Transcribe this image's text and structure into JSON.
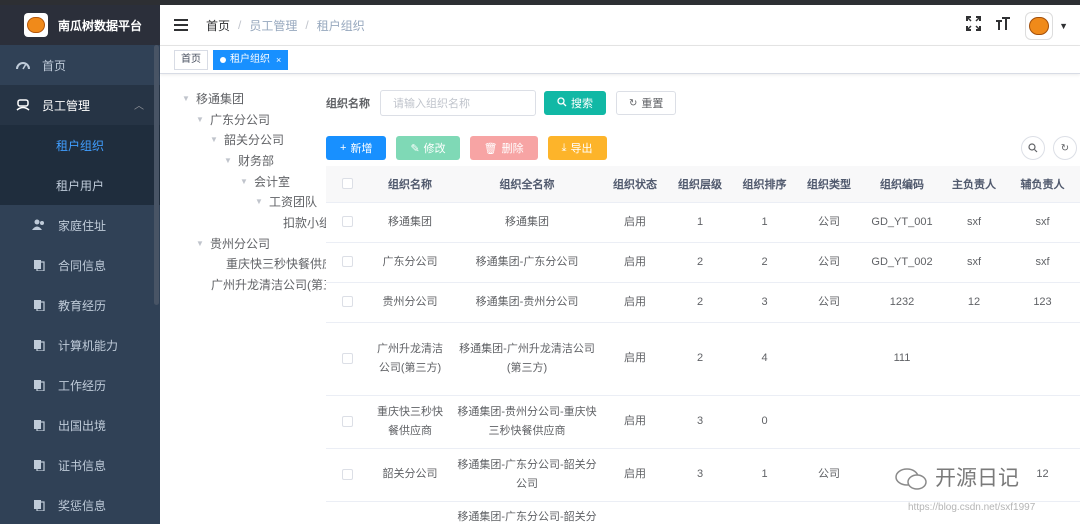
{
  "app": {
    "title": "南瓜树数据平台"
  },
  "sidebar": {
    "items": [
      {
        "label": "首页",
        "icon": "dashboard-icon"
      },
      {
        "label": "员工管理",
        "icon": "user-group-icon"
      },
      {
        "label": "租户组织",
        "icon": ""
      },
      {
        "label": "租户用户",
        "icon": ""
      },
      {
        "label": "家庭住址",
        "icon": "people-icon"
      },
      {
        "label": "合同信息",
        "icon": "document-icon"
      },
      {
        "label": "教育经历",
        "icon": "document-icon"
      },
      {
        "label": "计算机能力",
        "icon": "document-icon"
      },
      {
        "label": "工作经历",
        "icon": "document-icon"
      },
      {
        "label": "出国出境",
        "icon": "document-icon"
      },
      {
        "label": "证书信息",
        "icon": "document-icon"
      },
      {
        "label": "奖惩信息",
        "icon": "document-icon"
      }
    ]
  },
  "breadcrumb": [
    "首页",
    "员工管理",
    "租户组织"
  ],
  "tags": {
    "home": "首页",
    "current": "租户组织"
  },
  "tree": [
    "移通集团",
    "广东分公司",
    "韶关分公司",
    "财务部",
    "会计室",
    "工资团队",
    "扣款小组",
    "贵州分公司",
    "重庆快三秒快餐供应商",
    "广州升龙清洁公司(第三方)"
  ],
  "search": {
    "label": "组织名称",
    "placeholder": "请输入组织名称",
    "search_btn": "搜索",
    "reset_btn": "重置"
  },
  "toolbar": {
    "add": "新增",
    "edit": "修改",
    "delete": "删除",
    "export": "导出"
  },
  "table": {
    "headers": [
      "组织名称",
      "组织全名称",
      "组织状态",
      "组织层级",
      "组织排序",
      "组织类型",
      "组织编码",
      "主负责人",
      "辅负责人"
    ],
    "rows": [
      [
        "移通集团",
        "移通集团",
        "启用",
        "1",
        "1",
        "公司",
        "GD_YT_001",
        "sxf",
        "sxf"
      ],
      [
        "广东分公司",
        "移通集团-广东分公司",
        "启用",
        "2",
        "2",
        "公司",
        "GD_YT_002",
        "sxf",
        "sxf"
      ],
      [
        "贵州分公司",
        "移通集团-贵州分公司",
        "启用",
        "2",
        "3",
        "公司",
        "1232",
        "12",
        "123"
      ],
      [
        "广州升龙清洁公司(第三方)",
        "移通集团-广州升龙清洁公司(第三方)",
        "启用",
        "2",
        "4",
        "",
        "111",
        "",
        ""
      ],
      [
        "重庆快三秒快餐供应商",
        "移通集团-贵州分公司-重庆快三秒快餐供应商",
        "启用",
        "3",
        "0",
        "",
        "",
        "",
        ""
      ],
      [
        "韶关分公司",
        "移通集团-广东分公司-韶关分公司",
        "启用",
        "3",
        "1",
        "公司",
        "",
        "",
        "12"
      ],
      [
        "",
        "移通集团-广东分公司-韶关分公",
        "",
        "",
        "",
        "",
        "",
        "",
        ""
      ]
    ]
  },
  "watermark": {
    "title": "开源日记",
    "url": "https://blog.csdn.net/sxf1997"
  },
  "colors": {
    "sidebar_bg": "#304156",
    "active_text": "#409eff",
    "primary": "#1890ff",
    "search_btn": "#11b8a5"
  }
}
